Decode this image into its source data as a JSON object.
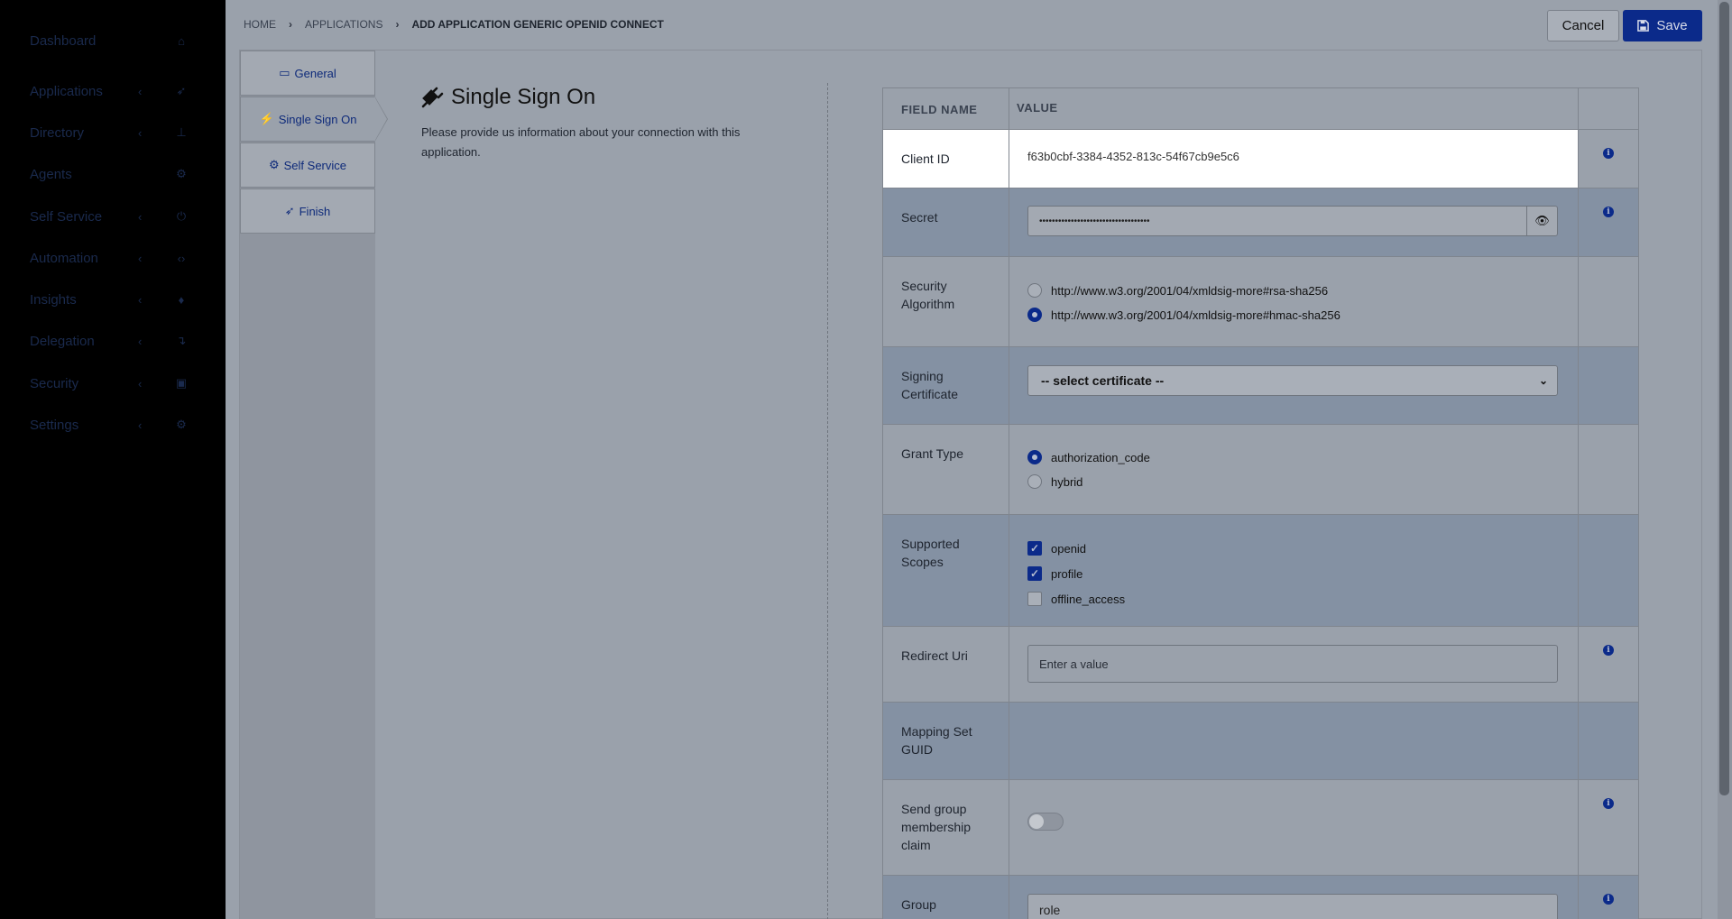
{
  "sidebar": {
    "items": [
      {
        "label": "Dashboard",
        "icon": "home-icon",
        "has_chevron": false
      },
      {
        "label": "Applications",
        "icon": "rocket-icon",
        "has_chevron": true
      },
      {
        "label": "Directory",
        "icon": "sitemap-icon",
        "has_chevron": true
      },
      {
        "label": "Agents",
        "icon": "cogs-icon",
        "has_chevron": false
      },
      {
        "label": "Self Service",
        "icon": "power-icon",
        "has_chevron": true
      },
      {
        "label": "Automation",
        "icon": "code-icon",
        "has_chevron": true
      },
      {
        "label": "Insights",
        "icon": "lightbulb-icon",
        "has_chevron": true
      },
      {
        "label": "Delegation",
        "icon": "level-down-icon",
        "has_chevron": true
      },
      {
        "label": "Security",
        "icon": "lock-icon",
        "has_chevron": true
      },
      {
        "label": "Settings",
        "icon": "gear-icon",
        "has_chevron": true
      }
    ]
  },
  "breadcrumb": {
    "home": "HOME",
    "applications": "APPLICATIONS",
    "current": "ADD APPLICATION GENERIC OPENID CONNECT"
  },
  "toolbar": {
    "cancel_label": "Cancel",
    "save_label": "Save"
  },
  "steps": [
    {
      "label": "General",
      "icon": "monitor-icon"
    },
    {
      "label": "Single Sign On",
      "icon": "plug-icon"
    },
    {
      "label": "Self Service",
      "icon": "cogs-icon"
    },
    {
      "label": "Finish",
      "icon": "rocket-icon"
    }
  ],
  "section": {
    "title": "Single Sign On",
    "description": "Please provide us information about your connection with this application."
  },
  "table": {
    "headers": {
      "field_name": "FIELD NAME",
      "value": "VALUE"
    },
    "client_id": {
      "label": "Client ID",
      "value": "f63b0cbf-3384-4352-813c-54f67cb9e5c6"
    },
    "secret": {
      "label": "Secret",
      "value": "•••••••••••••••••••••••••••••••••••"
    },
    "security_algorithm": {
      "label": "Security Algorithm",
      "options": [
        {
          "label": "http://www.w3.org/2001/04/xmldsig-more#rsa-sha256",
          "selected": false
        },
        {
          "label": "http://www.w3.org/2001/04/xmldsig-more#hmac-sha256",
          "selected": true
        }
      ]
    },
    "signing_certificate": {
      "label": "Signing Certificate",
      "value": "-- select certificate --"
    },
    "grant_type": {
      "label": "Grant Type",
      "options": [
        {
          "label": "authorization_code",
          "selected": true
        },
        {
          "label": "hybrid",
          "selected": false
        }
      ]
    },
    "supported_scopes": {
      "label": "Supported Scopes",
      "options": [
        {
          "label": "openid",
          "checked": true
        },
        {
          "label": "profile",
          "checked": true
        },
        {
          "label": "offline_access",
          "checked": false
        }
      ]
    },
    "redirect_uri": {
      "label": "Redirect Uri",
      "placeholder": "Enter a value"
    },
    "mapping_set_guid": {
      "label": "Mapping Set GUID"
    },
    "send_group_membership": {
      "label": "Send group membership claim",
      "enabled": false
    },
    "group": {
      "label": "Group",
      "value": "role"
    }
  },
  "colors": {
    "accent": "#0b2a8a",
    "sidebar_bg": "#000000",
    "alt_row": "#8491a3"
  }
}
